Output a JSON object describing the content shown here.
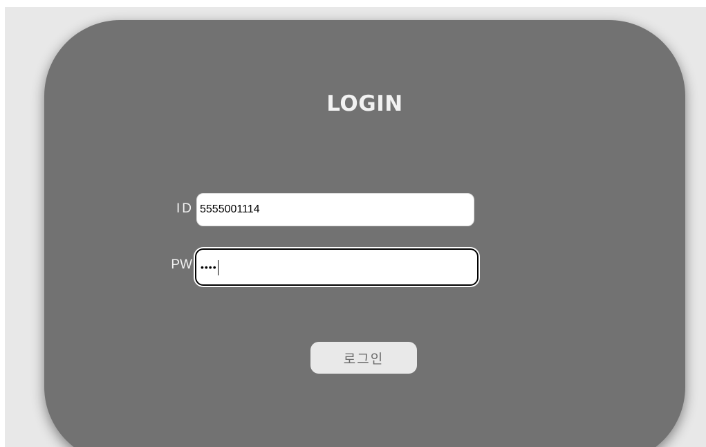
{
  "login": {
    "title": "LOGIN",
    "id_label": "ID",
    "id_value": "5555001114",
    "pw_label": "PW",
    "pw_masked": "••••",
    "submit_label": "로그인"
  },
  "colors": {
    "background": "#e8e8e8",
    "card": "#727272",
    "button": "#e9e9e9",
    "text_light": "#f2f2f2"
  }
}
